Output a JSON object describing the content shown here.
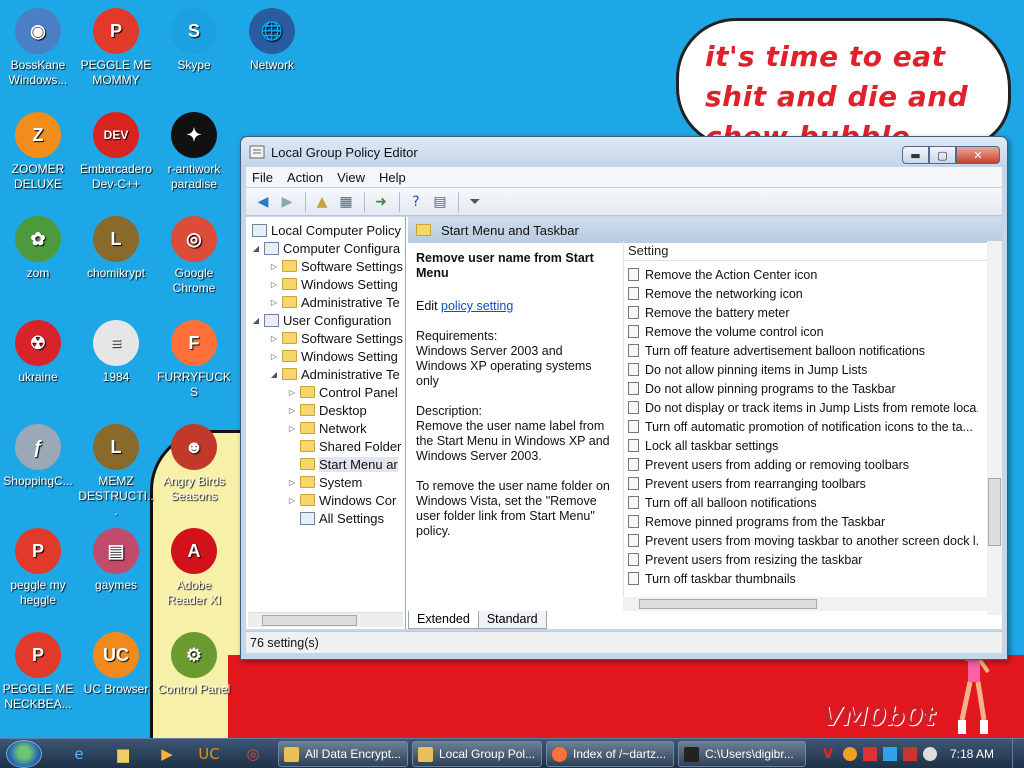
{
  "wallpaper": {
    "speech_text": "it's time to eat shit and die and chew bubble gum",
    "logo_text": "VM0b0t"
  },
  "desktop_icons": [
    {
      "label": "BossKane Windows...",
      "icon": "disc-icon",
      "color": "#4a7fc4",
      "glyph": "◉"
    },
    {
      "label": "PEGGLE ME MOMMY",
      "icon": "peggle-icon",
      "color": "#e23a2a",
      "glyph": "P"
    },
    {
      "label": "Skype",
      "icon": "skype-icon",
      "color": "#1ba0e1",
      "glyph": "S"
    },
    {
      "label": "Network",
      "icon": "network-icon",
      "color": "#2a5aa0",
      "glyph": "🌐"
    },
    {
      "label": "ZOOMER DELUXE",
      "icon": "zoomer-icon",
      "color": "#f28c1a",
      "glyph": "Z"
    },
    {
      "label": "Embarcadero Dev-C++",
      "icon": "devcpp-icon",
      "color": "#d9231f",
      "glyph": "DEV"
    },
    {
      "label": "r-antiwork paradise",
      "icon": "antiwork-icon",
      "color": "#111111",
      "glyph": "✦"
    },
    {
      "label": "zom",
      "icon": "flower-icon",
      "color": "#4c9a3c",
      "glyph": "✿"
    },
    {
      "label": "chomikrypt",
      "icon": "lock-icon",
      "color": "#8a6a2a",
      "glyph": "L"
    },
    {
      "label": "Google Chrome",
      "icon": "chrome-icon",
      "color": "#dd4b39",
      "glyph": "◎"
    },
    {
      "label": "ukraine",
      "icon": "radiation-icon",
      "color": "#d8232a",
      "glyph": "☢"
    },
    {
      "label": "1984",
      "icon": "document-icon",
      "color": "#e6e6e6",
      "glyph": "≡"
    },
    {
      "label": "FURRYFUCKS",
      "icon": "firefox-icon",
      "color": "#ff7139",
      "glyph": "F"
    },
    {
      "label": "ShoppingC...",
      "icon": "flash-icon",
      "color": "#9aa8b8",
      "glyph": "ƒ"
    },
    {
      "label": "MEMZ DESTRUCTI...",
      "icon": "lock-icon",
      "color": "#8a6a2a",
      "glyph": "L"
    },
    {
      "label": "Angry Birds Seasons",
      "icon": "angry-birds-icon",
      "color": "#c0392b",
      "glyph": "☻"
    },
    {
      "label": "peggle my heggle",
      "icon": "peggle-icon",
      "color": "#e23a2a",
      "glyph": "P"
    },
    {
      "label": "gaymes",
      "icon": "games-icon",
      "color": "#c24a6a",
      "glyph": "▤"
    },
    {
      "label": "Adobe Reader XI",
      "icon": "adobe-icon",
      "color": "#d1121b",
      "glyph": "A"
    },
    {
      "label": "PEGGLE ME NECKBEA...",
      "icon": "peggle-icon",
      "color": "#e23a2a",
      "glyph": "P"
    },
    {
      "label": "UC Browser",
      "icon": "uc-browser-icon",
      "color": "#f08a1c",
      "glyph": "UC"
    },
    {
      "label": "Control Panel",
      "icon": "control-panel-icon",
      "color": "#6b9b2f",
      "glyph": "⚙"
    }
  ],
  "window": {
    "title": "Local Group Policy Editor",
    "menu": [
      "File",
      "Action",
      "View",
      "Help"
    ],
    "status": "76 setting(s)",
    "tree": {
      "root": "Local Computer Policy",
      "computer_config": "Computer Configura",
      "cc_software": "Software Settings",
      "cc_windows": "Windows Setting",
      "cc_admin": "Administrative Te",
      "user_config": "User Configuration",
      "uc_software": "Software Settings",
      "uc_windows": "Windows Setting",
      "uc_admin": "Administrative Te",
      "control_panel": "Control Panel",
      "desktop": "Desktop",
      "network": "Network",
      "shared_folders": "Shared Folder",
      "start_menu": "Start Menu ar",
      "system": "System",
      "windows_comp": "Windows Cor",
      "all_settings": "All Settings"
    },
    "header_title": "Start Menu and Taskbar",
    "description": {
      "heading": "Remove user name from Start Menu",
      "edit_prefix": "Edit ",
      "edit_link": "policy setting ",
      "requirements": "Requirements:\nWindows Server 2003 and Windows XP operating systems only",
      "description": "Description:\nRemove the user name label from the Start Menu in Windows XP and Windows Server 2003.",
      "note": "To remove the user name folder on Windows Vista, set the \"Remove user folder link from Start Menu\" policy."
    },
    "list_header": "Setting",
    "settings": [
      "Remove the Action Center icon",
      "Remove the networking icon",
      "Remove the battery meter",
      "Remove the volume control icon",
      "Turn off feature advertisement balloon notifications",
      "Do not allow pinning items in Jump Lists",
      "Do not allow pinning programs to the Taskbar",
      "Do not display or track items in Jump Lists from remote loca...",
      "Turn off automatic promotion of notification icons to the ta...",
      "Lock all taskbar settings",
      "Prevent users from adding or removing toolbars",
      "Prevent users from rearranging toolbars",
      "Turn off all balloon notifications",
      "Remove pinned programs from the Taskbar",
      "Prevent users from moving taskbar to another screen dock l...",
      "Prevent users from resizing the taskbar",
      "Turn off taskbar thumbnails"
    ],
    "tabs": [
      "Extended",
      "Standard"
    ]
  },
  "taskbar": {
    "tasks": [
      {
        "label": "All Data Encrypt...",
        "icon": "explorer-icon",
        "color": "#e8c15a"
      },
      {
        "label": "Local Group Pol...",
        "icon": "policy-icon",
        "color": "#e8c15a"
      },
      {
        "label": "Index of /~dartz...",
        "icon": "firefox-icon",
        "color": "#ff7139"
      },
      {
        "label": "C:\\Users\\digibr...",
        "icon": "cmd-icon",
        "color": "#222222"
      }
    ],
    "clock": "7:18 AM"
  }
}
